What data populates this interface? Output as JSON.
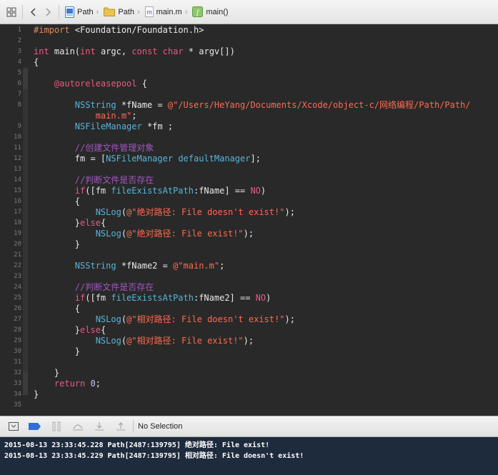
{
  "breadcrumb": {
    "items": [
      {
        "label": "Path",
        "icon": "xcode-project-icon"
      },
      {
        "label": "Path",
        "icon": "folder-icon"
      },
      {
        "label": "main.m",
        "icon": "objc-file-icon"
      },
      {
        "label": "main()",
        "icon": "function-icon"
      }
    ]
  },
  "colors": {
    "editor_bg": "#292929",
    "keyword": "#e85a84",
    "type": "#58b4d8",
    "string": "#ff6a4f",
    "comment": "#a058c0",
    "preprocessor": "#e08a5c",
    "console_bg": "#1e2b3c"
  },
  "code": {
    "lines": [
      {
        "n": "1",
        "t": [
          [
            "pre",
            "#import"
          ],
          [
            "txt",
            " <Foundation/Foundation.h>"
          ]
        ]
      },
      {
        "n": "2",
        "t": []
      },
      {
        "n": "3",
        "t": [
          [
            "kw",
            "int"
          ],
          [
            "txt",
            " main("
          ],
          [
            "kw",
            "int"
          ],
          [
            "txt",
            " argc, "
          ],
          [
            "kw",
            "const"
          ],
          [
            "txt",
            " "
          ],
          [
            "kw",
            "char"
          ],
          [
            "txt",
            " * argv[])"
          ]
        ]
      },
      {
        "n": "4",
        "t": [
          [
            "txt",
            "{"
          ]
        ]
      },
      {
        "n": "5",
        "t": []
      },
      {
        "n": "6",
        "t": [
          [
            "txt",
            "    "
          ],
          [
            "kw",
            "@autoreleasepool"
          ],
          [
            "txt",
            " {"
          ]
        ]
      },
      {
        "n": "7",
        "t": []
      },
      {
        "n": "8",
        "t": [
          [
            "txt",
            "        "
          ],
          [
            "type",
            "NSString"
          ],
          [
            "txt",
            " *fName = "
          ],
          [
            "str",
            "@\"/Users/HeYang/Documents/Xcode/object-c/网络编程/Path/Path/"
          ]
        ]
      },
      {
        "n": "",
        "t": [
          [
            "str",
            "            main.m\""
          ],
          [
            "txt",
            ";"
          ]
        ]
      },
      {
        "n": "9",
        "t": [
          [
            "txt",
            "        "
          ],
          [
            "type",
            "NSFileManager"
          ],
          [
            "txt",
            " *fm ;"
          ]
        ]
      },
      {
        "n": "10",
        "t": []
      },
      {
        "n": "11",
        "t": [
          [
            "txt",
            "        "
          ],
          [
            "cmt",
            "//创建文件管理对象"
          ]
        ]
      },
      {
        "n": "12",
        "t": [
          [
            "txt",
            "        fm = ["
          ],
          [
            "type",
            "NSFileManager"
          ],
          [
            "txt",
            " "
          ],
          [
            "meth",
            "defaultManager"
          ],
          [
            "txt",
            "];"
          ]
        ]
      },
      {
        "n": "13",
        "t": []
      },
      {
        "n": "14",
        "t": [
          [
            "txt",
            "        "
          ],
          [
            "cmt",
            "//判断文件是否存在"
          ]
        ]
      },
      {
        "n": "15",
        "t": [
          [
            "txt",
            "        "
          ],
          [
            "kw",
            "if"
          ],
          [
            "txt",
            "([fm "
          ],
          [
            "meth",
            "fileExistsAtPath"
          ],
          [
            "txt",
            ":fName] == "
          ],
          [
            "kw",
            "NO"
          ],
          [
            "txt",
            ")"
          ]
        ]
      },
      {
        "n": "16",
        "t": [
          [
            "txt",
            "        {"
          ]
        ]
      },
      {
        "n": "17",
        "t": [
          [
            "txt",
            "            "
          ],
          [
            "type",
            "NSLog"
          ],
          [
            "txt",
            "("
          ],
          [
            "str",
            "@\"绝对路径: File doesn't exist!\""
          ],
          [
            "txt",
            ");"
          ]
        ]
      },
      {
        "n": "18",
        "t": [
          [
            "txt",
            "        }"
          ],
          [
            "kw",
            "else"
          ],
          [
            "txt",
            "{"
          ]
        ]
      },
      {
        "n": "19",
        "t": [
          [
            "txt",
            "            "
          ],
          [
            "type",
            "NSLog"
          ],
          [
            "txt",
            "("
          ],
          [
            "str",
            "@\"绝对路径: File exist!\""
          ],
          [
            "txt",
            ");"
          ]
        ]
      },
      {
        "n": "20",
        "t": [
          [
            "txt",
            "        }"
          ]
        ]
      },
      {
        "n": "21",
        "t": []
      },
      {
        "n": "22",
        "t": [
          [
            "txt",
            "        "
          ],
          [
            "type",
            "NSString"
          ],
          [
            "txt",
            " *fName2 = "
          ],
          [
            "str",
            "@\"main.m\""
          ],
          [
            "txt",
            ";"
          ]
        ]
      },
      {
        "n": "23",
        "t": []
      },
      {
        "n": "24",
        "t": [
          [
            "txt",
            "        "
          ],
          [
            "cmt",
            "//判断文件是否存在"
          ]
        ]
      },
      {
        "n": "25",
        "t": [
          [
            "txt",
            "        "
          ],
          [
            "kw",
            "if"
          ],
          [
            "txt",
            "([fm "
          ],
          [
            "meth",
            "fileExistsAtPath"
          ],
          [
            "txt",
            ":fName2] == "
          ],
          [
            "kw",
            "NO"
          ],
          [
            "txt",
            ")"
          ]
        ]
      },
      {
        "n": "26",
        "t": [
          [
            "txt",
            "        {"
          ]
        ]
      },
      {
        "n": "27",
        "t": [
          [
            "txt",
            "            "
          ],
          [
            "type",
            "NSLog"
          ],
          [
            "txt",
            "("
          ],
          [
            "str",
            "@\"相对路径: File doesn't exist!\""
          ],
          [
            "txt",
            ");"
          ]
        ]
      },
      {
        "n": "28",
        "t": [
          [
            "txt",
            "        }"
          ],
          [
            "kw",
            "else"
          ],
          [
            "txt",
            "{"
          ]
        ]
      },
      {
        "n": "29",
        "t": [
          [
            "txt",
            "            "
          ],
          [
            "type",
            "NSLog"
          ],
          [
            "txt",
            "("
          ],
          [
            "str",
            "@\"相对路径: File exist!\""
          ],
          [
            "txt",
            ");"
          ]
        ]
      },
      {
        "n": "30",
        "t": [
          [
            "txt",
            "        }"
          ]
        ]
      },
      {
        "n": "31",
        "t": []
      },
      {
        "n": "32",
        "t": [
          [
            "txt",
            "    }"
          ]
        ]
      },
      {
        "n": "33",
        "t": [
          [
            "txt",
            "    "
          ],
          [
            "kw",
            "return"
          ],
          [
            "txt",
            " "
          ],
          [
            "num",
            "0"
          ],
          [
            "txt",
            ";"
          ]
        ]
      },
      {
        "n": "34",
        "t": [
          [
            "txt",
            "}"
          ]
        ]
      },
      {
        "n": "35",
        "t": []
      }
    ]
  },
  "debug": {
    "selection_label": "No Selection"
  },
  "console": {
    "lines": [
      "2015-08-13 23:33:45.228 Path[2487:139795] 绝对路径: File exist!",
      "2015-08-13 23:33:45.229 Path[2487:139795] 相对路径: File doesn't exist!"
    ]
  }
}
